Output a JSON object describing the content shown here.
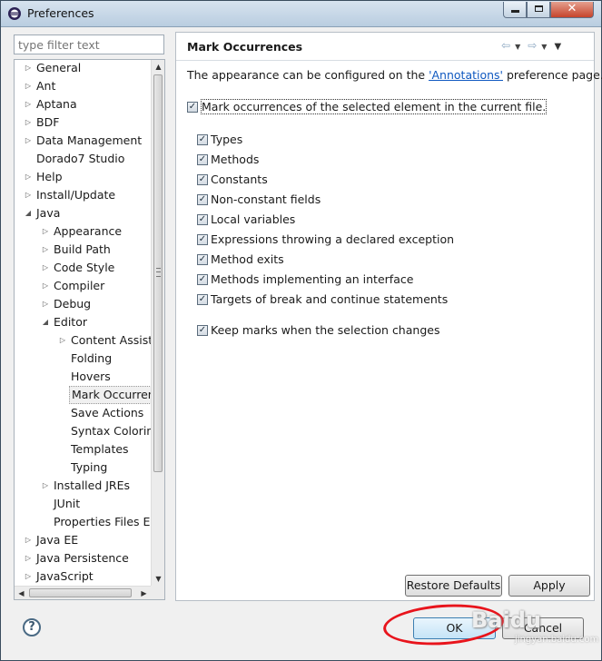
{
  "window": {
    "title": "Preferences"
  },
  "filter": {
    "placeholder": "type filter text"
  },
  "tree": {
    "items": [
      {
        "label": "General",
        "level": 0,
        "arrow": "collapsed"
      },
      {
        "label": "Ant",
        "level": 0,
        "arrow": "collapsed"
      },
      {
        "label": "Aptana",
        "level": 0,
        "arrow": "collapsed"
      },
      {
        "label": "BDF",
        "level": 0,
        "arrow": "collapsed"
      },
      {
        "label": "Data Management",
        "level": 0,
        "arrow": "collapsed"
      },
      {
        "label": "Dorado7 Studio",
        "level": 0,
        "arrow": "none"
      },
      {
        "label": "Help",
        "level": 0,
        "arrow": "collapsed"
      },
      {
        "label": "Install/Update",
        "level": 0,
        "arrow": "collapsed"
      },
      {
        "label": "Java",
        "level": 0,
        "arrow": "expanded"
      },
      {
        "label": "Appearance",
        "level": 1,
        "arrow": "collapsed"
      },
      {
        "label": "Build Path",
        "level": 1,
        "arrow": "collapsed"
      },
      {
        "label": "Code Style",
        "level": 1,
        "arrow": "collapsed"
      },
      {
        "label": "Compiler",
        "level": 1,
        "arrow": "collapsed"
      },
      {
        "label": "Debug",
        "level": 1,
        "arrow": "collapsed"
      },
      {
        "label": "Editor",
        "level": 1,
        "arrow": "expanded"
      },
      {
        "label": "Content Assist",
        "level": 2,
        "arrow": "collapsed"
      },
      {
        "label": "Folding",
        "level": 2,
        "arrow": "none"
      },
      {
        "label": "Hovers",
        "level": 2,
        "arrow": "none"
      },
      {
        "label": "Mark Occurrences",
        "level": 2,
        "arrow": "none",
        "selected": true
      },
      {
        "label": "Save Actions",
        "level": 2,
        "arrow": "none"
      },
      {
        "label": "Syntax Coloring",
        "level": 2,
        "arrow": "none"
      },
      {
        "label": "Templates",
        "level": 2,
        "arrow": "none"
      },
      {
        "label": "Typing",
        "level": 2,
        "arrow": "none"
      },
      {
        "label": "Installed JREs",
        "level": 1,
        "arrow": "collapsed"
      },
      {
        "label": "JUnit",
        "level": 1,
        "arrow": "none"
      },
      {
        "label": "Properties Files Editor",
        "level": 1,
        "arrow": "none"
      },
      {
        "label": "Java EE",
        "level": 0,
        "arrow": "collapsed"
      },
      {
        "label": "Java Persistence",
        "level": 0,
        "arrow": "collapsed"
      },
      {
        "label": "JavaScript",
        "level": 0,
        "arrow": "collapsed"
      }
    ]
  },
  "page": {
    "title": "Mark Occurrences",
    "desc_before": "The appearance can be configured on the ",
    "desc_link": "'Annotations'",
    "desc_after": " preference page.",
    "main_option": {
      "label": "Mark occurrences of the selected element in the current file.",
      "checked": true
    },
    "options": [
      {
        "label": "Types",
        "checked": true
      },
      {
        "label": "Methods",
        "checked": true
      },
      {
        "label": "Constants",
        "checked": true
      },
      {
        "label": "Non-constant fields",
        "checked": true
      },
      {
        "label": "Local variables",
        "checked": true
      },
      {
        "label": "Expressions throwing a declared exception",
        "checked": true
      },
      {
        "label": "Method exits",
        "checked": true
      },
      {
        "label": "Methods implementing an interface",
        "checked": true
      },
      {
        "label": "Targets of break and continue statements",
        "checked": true
      }
    ],
    "keep_option": {
      "label": "Keep marks when the selection changes",
      "checked": true
    },
    "restore_label": "Restore Defaults",
    "apply_label": "Apply"
  },
  "footer": {
    "help": "?",
    "ok_label": "OK",
    "cancel_label": "Cancel"
  },
  "watermark": {
    "main": "Baidu",
    "sub": "jingyan.baidu.com"
  },
  "icons": {
    "back": "back-arrow-icon",
    "forward": "forward-arrow-icon",
    "menu": "view-menu-icon"
  },
  "colors": {
    "link": "#0f58c0",
    "annotation": "#e8141c"
  }
}
